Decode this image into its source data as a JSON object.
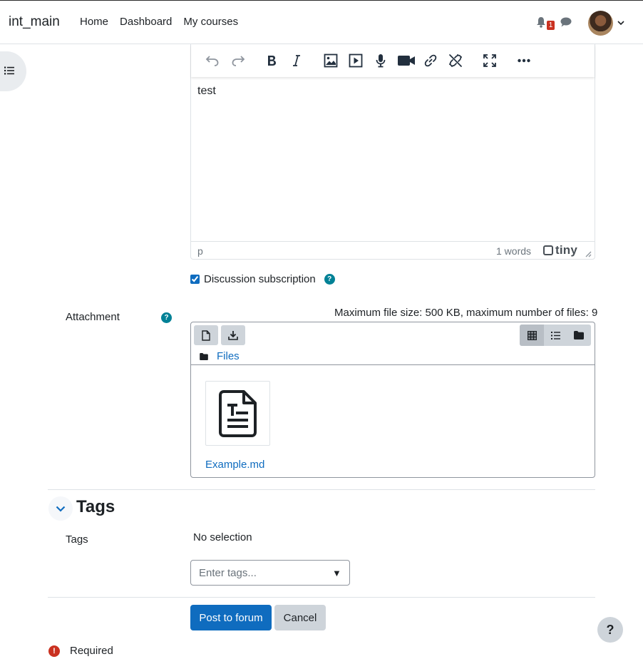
{
  "navbar": {
    "brand": "int_main",
    "links": [
      "Home",
      "Dashboard",
      "My courses"
    ],
    "notification_count": "1",
    "icons": [
      "bell-icon",
      "chat-icon",
      "avatar",
      "chevron-down-icon"
    ]
  },
  "sidebar": {
    "toggle_icon": "list-icon"
  },
  "editor": {
    "toolbar": [
      "undo-icon",
      "redo-icon",
      "bold-icon",
      "italic-icon",
      "image-icon",
      "media-icon",
      "microphone-icon",
      "video-icon",
      "link-icon",
      "unlink-icon",
      "fullscreen-icon",
      "more-icon"
    ],
    "content": "test",
    "status_path": "p",
    "word_count": "1 words",
    "brand": "tiny"
  },
  "subscription": {
    "label": "Discussion subscription",
    "checked": true
  },
  "attachment": {
    "label": "Attachment",
    "max_size": "Maximum file size: 500 KB, maximum number of files: 9",
    "folder_label": "Files",
    "files": [
      {
        "name": "Example.md",
        "icon": "text-file-icon"
      }
    ]
  },
  "tags": {
    "heading": "Tags",
    "label": "Tags",
    "selection": "No selection",
    "placeholder": "Enter tags...",
    "caret": "▼"
  },
  "actions": {
    "submit": "Post to forum",
    "cancel": "Cancel"
  },
  "required": {
    "icon": "!",
    "label": "Required"
  },
  "help_button": "?",
  "colors": {
    "primary": "#0f6cbf",
    "help": "#008196",
    "danger": "#ca3120",
    "secondary": "#ced4da"
  }
}
